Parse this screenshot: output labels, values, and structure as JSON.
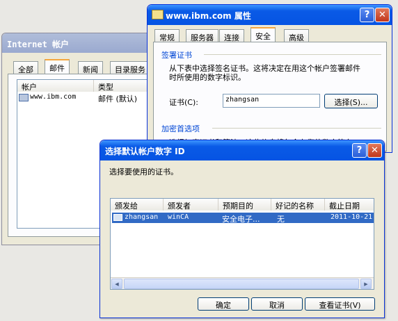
{
  "internet_window": {
    "title": "Internet 帐户",
    "tabs": [
      "全部",
      "邮件",
      "新闻",
      "目录服务"
    ],
    "active_tab": 1,
    "columns": [
      "帐户",
      "类型"
    ],
    "rows": [
      {
        "account": "www.ibm.com",
        "type": "邮件 (默认)"
      }
    ]
  },
  "props_window": {
    "title": "www.ibm.com 属性",
    "tabs": [
      "常规",
      "服务器",
      "连接",
      "安全",
      "高级"
    ],
    "active_tab": 3,
    "signing_group": "签署证书",
    "signing_desc_line1": "从下表中选择签名证书。这将决定在用这个帐户签署邮件",
    "signing_desc_line2": "时所使用的数字标识。",
    "cert_label": "证书(C):",
    "cert_value": "zhangsan",
    "select_button": "选择(S)...",
    "encrypt_group": "加密首选项",
    "encrypt_partial": "选择加密证书和算法。这些信息将包含在您的数字签名"
  },
  "select_dialog": {
    "title": "选择默认帐户数字 ID",
    "prompt": "选择要使用的证书。",
    "columns": [
      "颁发给",
      "颁发者",
      "预期目的",
      "好记的名称",
      "截止日期"
    ],
    "rows": [
      {
        "issued_to": "zhangsan",
        "issuer": "winCA",
        "purpose": "安全电子...",
        "friendly": "无",
        "expiry": "2011-10-21"
      }
    ],
    "ok_button": "确定",
    "cancel_button": "取消",
    "view_button": "查看证书(V)"
  },
  "colors": {
    "titlebar_blue": "#0a5ae6",
    "selection_blue": "#316ac5",
    "tab_highlight": "#f5a63d"
  }
}
